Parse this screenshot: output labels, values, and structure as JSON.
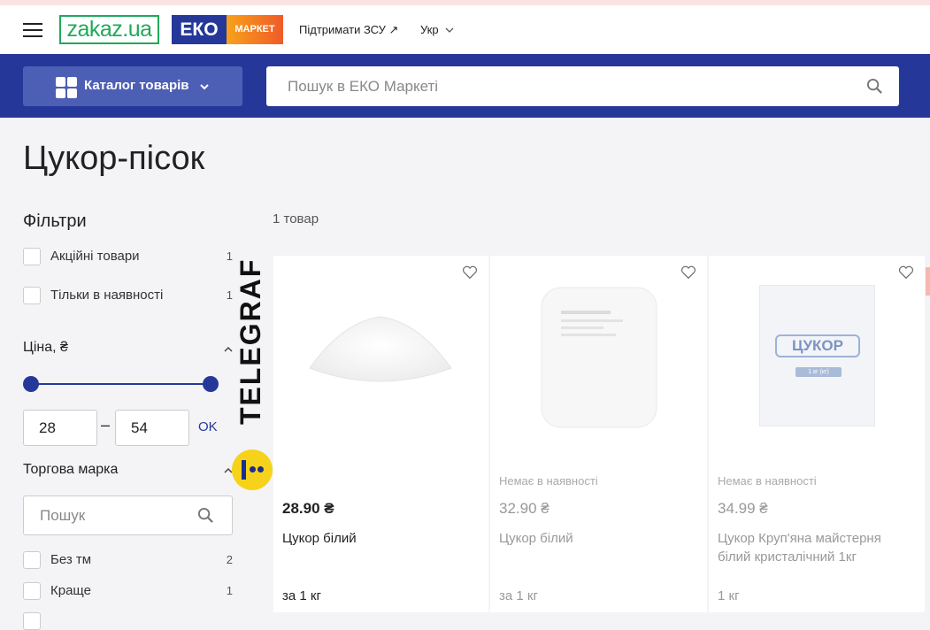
{
  "header": {
    "logo_zakaz": "zakaz.ua",
    "logo_eko": "ЕКО",
    "logo_market": "МАРКЕТ",
    "support_link": "Підтримати ЗСУ ↗",
    "language": "Укр"
  },
  "toolbar": {
    "catalog_label": "Каталог товарів",
    "search_placeholder": "Пошук в ЕКО Маркеті"
  },
  "page": {
    "title": "Цукор-пісок",
    "items_count": "1 товар"
  },
  "filters": {
    "title": "Фільтри",
    "checkboxes": [
      {
        "label": "Акційні товари",
        "count": "1"
      },
      {
        "label": "Тільки в наявності",
        "count": "1"
      }
    ],
    "price": {
      "title": "Ціна, ₴",
      "min": "28",
      "max": "54",
      "dash": "–",
      "ok_label": "OK"
    },
    "brand": {
      "title": "Торгова марка",
      "search_placeholder": "Пошук",
      "items": [
        {
          "label": "Без тм",
          "count": "2"
        },
        {
          "label": "Краще",
          "count": "1"
        }
      ]
    }
  },
  "watermark": {
    "text": "TELEGRAF"
  },
  "products": [
    {
      "stock": "",
      "price": "28.90 ₴",
      "name": "Цукор білий",
      "unit": "за 1 кг"
    },
    {
      "stock": "Немає в наявності",
      "price": "32.90 ₴",
      "name": "Цукор білий",
      "unit": "за 1 кг"
    },
    {
      "stock": "Немає в наявності",
      "price": "34.99 ₴",
      "name": "Цукор Круп'яна майстерня білий кристалічний 1кг",
      "unit": "1 кг"
    }
  ],
  "product_bag_label": "ЦУКОР",
  "product_bag_weight": "1 кг (кг)",
  "colors": {
    "brand_blue": "#25389a",
    "button_blue": "#4c5fb5",
    "zakaz_green": "#1faa59",
    "telegraf_yellow": "#f6d21a"
  }
}
